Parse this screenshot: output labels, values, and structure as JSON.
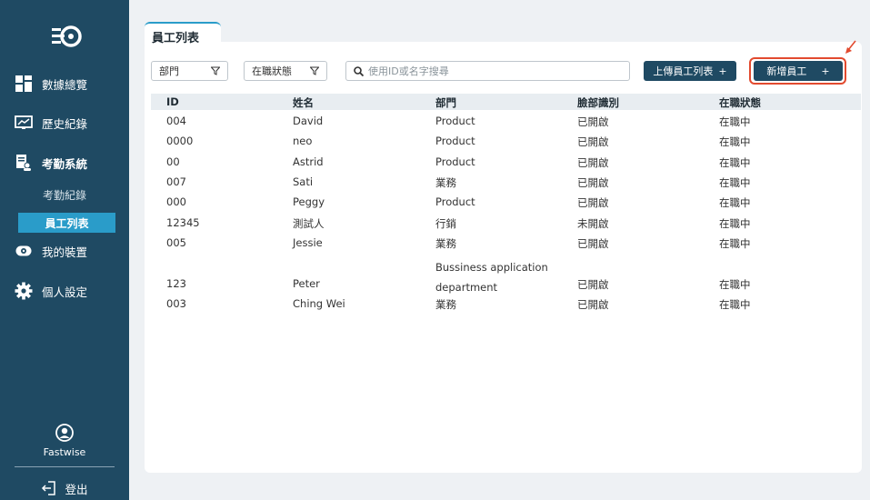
{
  "sidebar": {
    "nav": [
      {
        "label": "數據總覽",
        "icon": "dashboard-icon"
      },
      {
        "label": "歷史紀錄",
        "icon": "history-icon"
      },
      {
        "label": "考勤系統",
        "icon": "attendance-icon"
      },
      {
        "label": "我的裝置",
        "icon": "device-icon"
      },
      {
        "label": "個人設定",
        "icon": "gear-icon"
      }
    ],
    "sub": [
      {
        "label": "考勤紀錄"
      },
      {
        "label": "員工列表"
      }
    ],
    "user_name": "Fastwise",
    "logout": "登出"
  },
  "main": {
    "tab_label": "員工列表",
    "filters": {
      "department": "部門",
      "status": "在職狀態"
    },
    "search_placeholder": "使用ID或名字搜尋",
    "upload_button": "上傳員工列表",
    "add_button": "新增員工",
    "plus": "+"
  },
  "table": {
    "headers": [
      "ID",
      "姓名",
      "部門",
      "臉部識別",
      "在職狀態"
    ],
    "rows": [
      [
        "004",
        "David",
        "Product",
        "已開啟",
        "在職中"
      ],
      [
        "0000",
        "neo",
        "Product",
        "已開啟",
        "在職中"
      ],
      [
        "00",
        "Astrid",
        "Product",
        "已開啟",
        "在職中"
      ],
      [
        "007",
        "Sati",
        "業務",
        "已開啟",
        "在職中"
      ],
      [
        "000",
        "Peggy",
        "Product",
        "已開啟",
        "在職中"
      ],
      [
        "12345",
        "測試人",
        "行銷",
        "未開啟",
        "在職中"
      ],
      [
        "005",
        "Jessie",
        "業務",
        "已開啟",
        "在職中"
      ],
      [
        "123",
        "Peter",
        "Bussiness application department",
        "已開啟",
        "在職中"
      ],
      [
        "003",
        "Ching Wei",
        "業務",
        "已開啟",
        "在職中"
      ]
    ]
  },
  "colors": {
    "sidebar": "#1f4a63",
    "accent": "#2a9cc9",
    "highlight": "#e24a2f"
  }
}
